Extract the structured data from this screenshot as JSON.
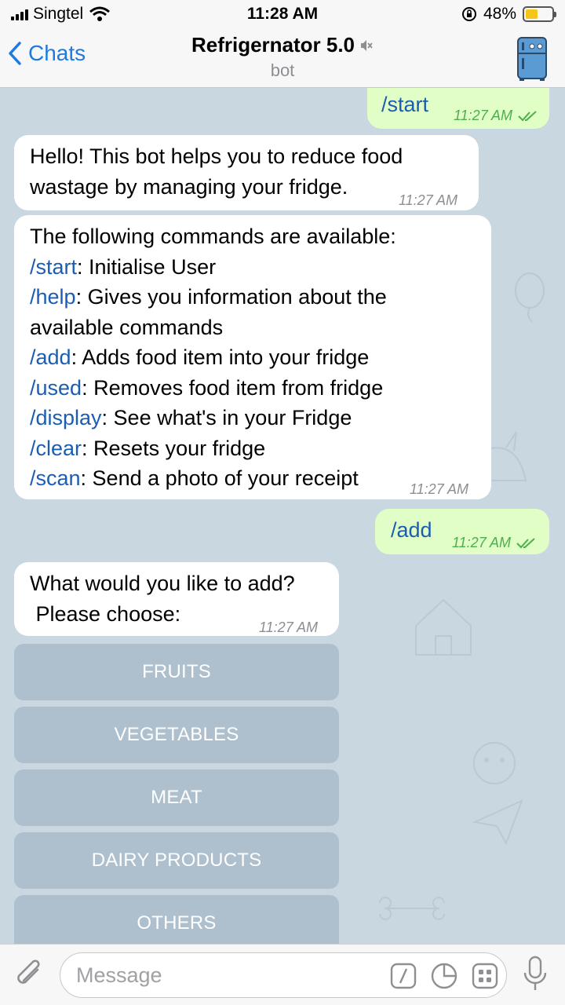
{
  "status_bar": {
    "carrier": "Singtel",
    "time": "11:28 AM",
    "battery": "48%",
    "battery_level": 0.48
  },
  "header": {
    "back_label": "Chats",
    "title": "Refrigernator 5.0",
    "subtitle": "bot",
    "muted_icon": "muted-speaker-icon",
    "avatar_icon": "fridge-icon"
  },
  "messages": {
    "m1": {
      "text": "/start",
      "time": "11:27 AM"
    },
    "m2": {
      "line1": "Hello! This bot helps you to reduce food",
      "line2": "wastage by managing your fridge.",
      "time": "11:27 AM"
    },
    "m3": {
      "intro": "The following commands are available:",
      "commands": [
        {
          "cmd": "/start",
          "desc": ": Initialise User"
        },
        {
          "cmd": "/help",
          "desc": ": Gives you information about the"
        },
        {
          "cmd": "",
          "desc": "available commands"
        },
        {
          "cmd": "/add",
          "desc": ": Adds food item into your fridge"
        },
        {
          "cmd": "/used",
          "desc": ": Removes food item from fridge"
        },
        {
          "cmd": "/display",
          "desc": ": See what's in your Fridge"
        },
        {
          "cmd": "/clear",
          "desc": ": Resets your fridge"
        },
        {
          "cmd": "/scan",
          "desc": ": Send a photo of your receipt"
        }
      ],
      "time": "11:27 AM"
    },
    "m4": {
      "text": "/add",
      "time": "11:27 AM"
    },
    "m5": {
      "line1": "What would you like to add?",
      "line2": " Please choose:",
      "time": "11:27 AM"
    }
  },
  "keyboard": [
    "FRUITS",
    "VEGETABLES",
    "MEAT",
    "DAIRY PRODUCTS",
    "OTHERS"
  ],
  "input": {
    "placeholder": "Message"
  },
  "colors": {
    "accent": "#1f7ae0",
    "outgoing_bubble": "#e1fec6",
    "read_ticks": "#4fae4e",
    "command_link": "#1a5db3",
    "chat_background": "#c9d7e0",
    "keyboard_button": "#a6b8c9"
  }
}
